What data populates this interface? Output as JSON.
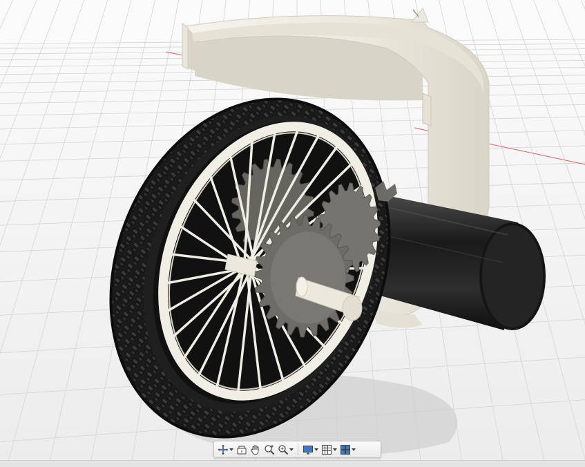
{
  "app": {
    "view": "3d-viewport",
    "background_color": "#f3f3f3",
    "grid_color": "#d4d4d4",
    "axis_color": "#e35a5a"
  },
  "model": {
    "parts": [
      "wheel-tire",
      "wheel-rim",
      "spokes",
      "gear-large",
      "gear-small",
      "motor-cylinder",
      "axle-pin",
      "housing-shell"
    ],
    "tire_color": "#1c1c1c",
    "body_color": "#eeebe1",
    "gear_color": "#6b6a66"
  },
  "toolbar": {
    "tools": [
      {
        "id": "orbit",
        "icon": "orbit-icon",
        "has_menu": true
      },
      {
        "id": "look-at",
        "icon": "look-at-icon",
        "has_menu": false
      },
      {
        "id": "pan",
        "icon": "pan-hand-icon",
        "has_menu": false
      },
      {
        "id": "zoom",
        "icon": "zoom-icon",
        "has_menu": false
      },
      {
        "id": "fit",
        "icon": "zoom-window-icon",
        "has_menu": true
      },
      {
        "id": "display",
        "icon": "display-settings-icon",
        "has_menu": true
      },
      {
        "id": "grid",
        "icon": "grid-snaps-icon",
        "has_menu": true
      },
      {
        "id": "viewports",
        "icon": "viewports-icon",
        "has_menu": true
      }
    ]
  }
}
